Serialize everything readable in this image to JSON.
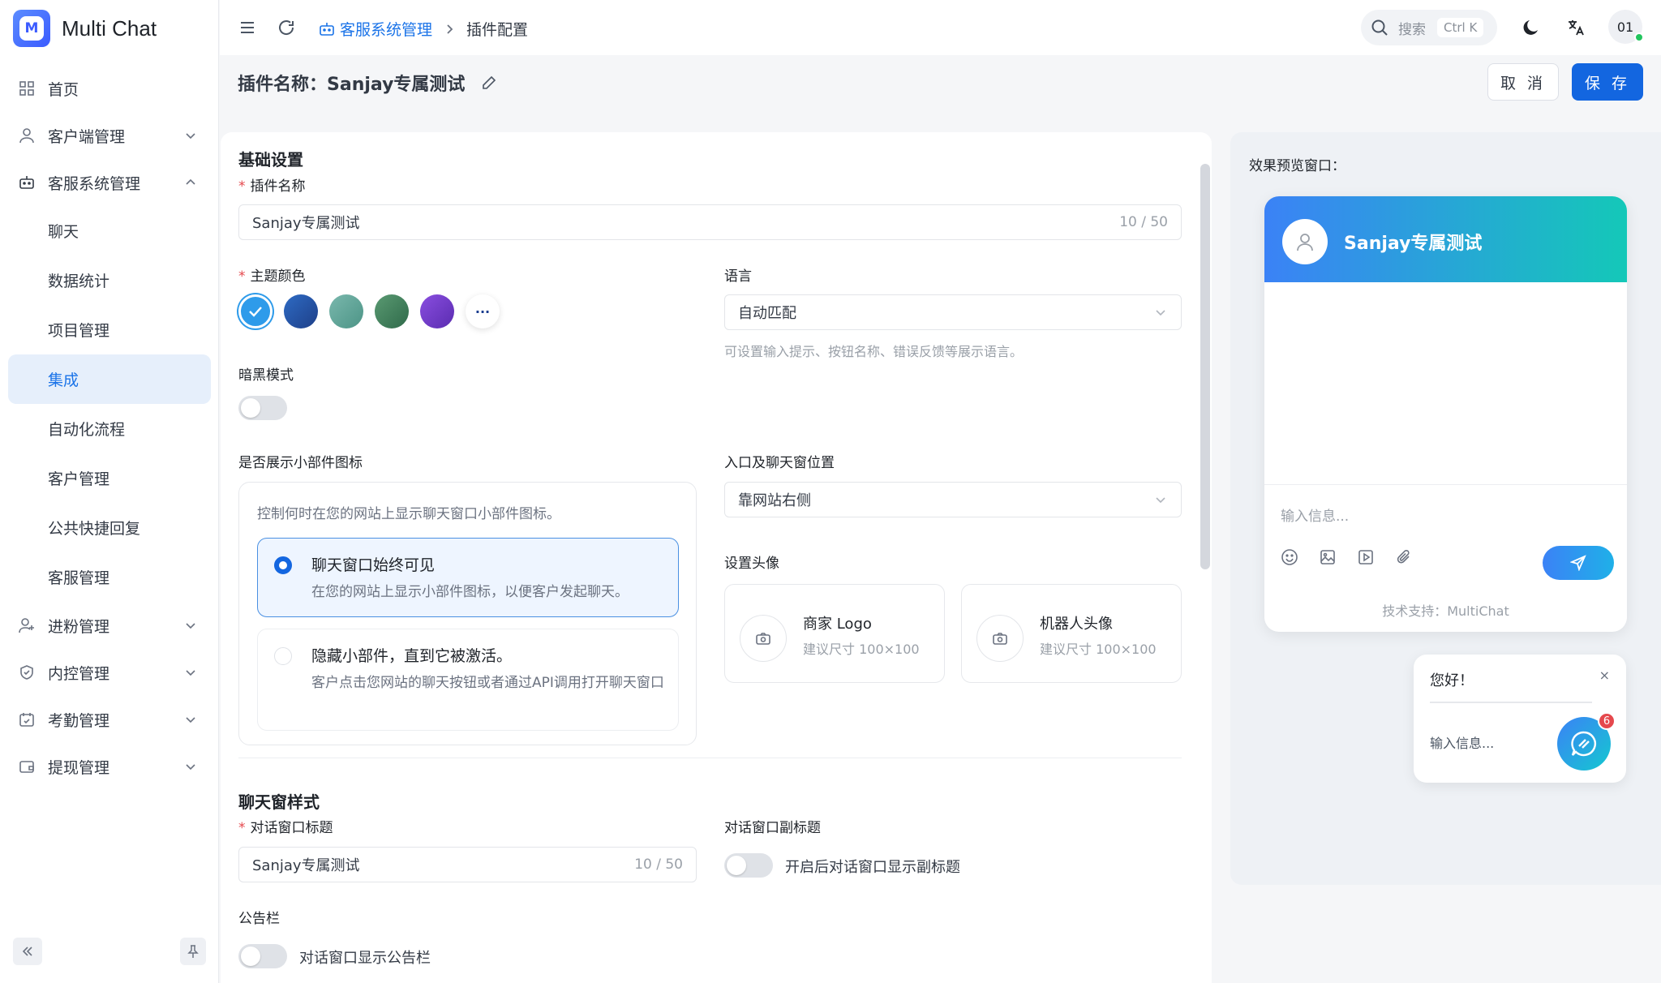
{
  "app": {
    "name": "Multi Chat",
    "logo_letter": "M"
  },
  "sidebar": {
    "items": [
      {
        "label": "首页",
        "icon": "dashboard-icon"
      },
      {
        "label": "客户端管理",
        "icon": "user-icon",
        "expandable": true
      },
      {
        "label": "客服系统管理",
        "icon": "robot-icon",
        "expandable": true,
        "expanded": true,
        "children": [
          "聊天",
          "数据统计",
          "项目管理",
          "集成",
          "自动化流程",
          "客户管理",
          "公共快捷回复",
          "客服管理"
        ],
        "active_child": "集成"
      },
      {
        "label": "进粉管理",
        "icon": "user-add-icon",
        "expandable": true
      },
      {
        "label": "内控管理",
        "icon": "shield-icon",
        "expandable": true
      },
      {
        "label": "考勤管理",
        "icon": "calendar-icon",
        "expandable": true
      },
      {
        "label": "提现管理",
        "icon": "wallet-icon",
        "expandable": true
      }
    ]
  },
  "topbar": {
    "breadcrumb": [
      "客服系统管理",
      "插件配置"
    ],
    "search_placeholder": "搜索",
    "search_shortcut": "Ctrl K",
    "user_initials": "01"
  },
  "page": {
    "title": "插件名称：Sanjay专属测试",
    "cancel_label": "取 消",
    "save_label": "保 存"
  },
  "form": {
    "basic_title": "基础设置",
    "plugin_name_label": "插件名称",
    "plugin_name_value": "Sanjay专属测试",
    "plugin_name_count": "10 / 50",
    "theme_label": "主题颜色",
    "theme_colors": [
      "#2e9bea",
      "#1e4e9a",
      "#5aa59a",
      "#3d7d5c",
      "#6c3cc4"
    ],
    "theme_more": "···",
    "language_label": "语言",
    "language_value": "自动匹配",
    "language_hint": "可设置输入提示、按钮名称、错误反馈等展示语言。",
    "dark_mode_label": "暗黑模式",
    "dark_mode_on": false,
    "widget_icon_label": "是否展示小部件图标",
    "widget_icon_desc": "控制何时在您的网站上显示聊天窗口小部件图标。",
    "widget_options": [
      {
        "title": "聊天窗口始终可见",
        "desc": "在您的网站上显示小部件图标，以便客户发起聊天。",
        "selected": true
      },
      {
        "title": "隐藏小部件，直到它被激活。",
        "desc": "客户点击您网站的聊天按钮或者通过API调用打开聊天窗口",
        "selected": false
      }
    ],
    "position_label": "入口及聊天窗位置",
    "position_value": "靠网站右侧",
    "avatar_label": "设置头像",
    "avatar_cards": [
      {
        "title": "商家 Logo",
        "hint": "建议尺寸 100×100"
      },
      {
        "title": "机器人头像",
        "hint": "建议尺寸 100×100"
      }
    ],
    "chat_style_title": "聊天窗样式",
    "dialog_title_label": "对话窗口标题",
    "dialog_title_value": "Sanjay专属测试",
    "dialog_title_count": "10 / 50",
    "dialog_subtitle_label": "对话窗口副标题",
    "dialog_subtitle_toggle_text": "开启后对话窗口显示副标题",
    "notice_label": "公告栏",
    "notice_toggle_text": "对话窗口显示公告栏"
  },
  "preview": {
    "label": "效果预览窗口：",
    "chat_title": "Sanjay专属测试",
    "input_placeholder": "输入信息...",
    "powered_by": "技术支持：MultiChat",
    "bubble_greeting": "您好！",
    "bubble_close": "×",
    "bubble_input": "输入信息...",
    "unread_count": "6",
    "gradient_start": "#3b82f6",
    "gradient_end": "#14c8b8"
  }
}
